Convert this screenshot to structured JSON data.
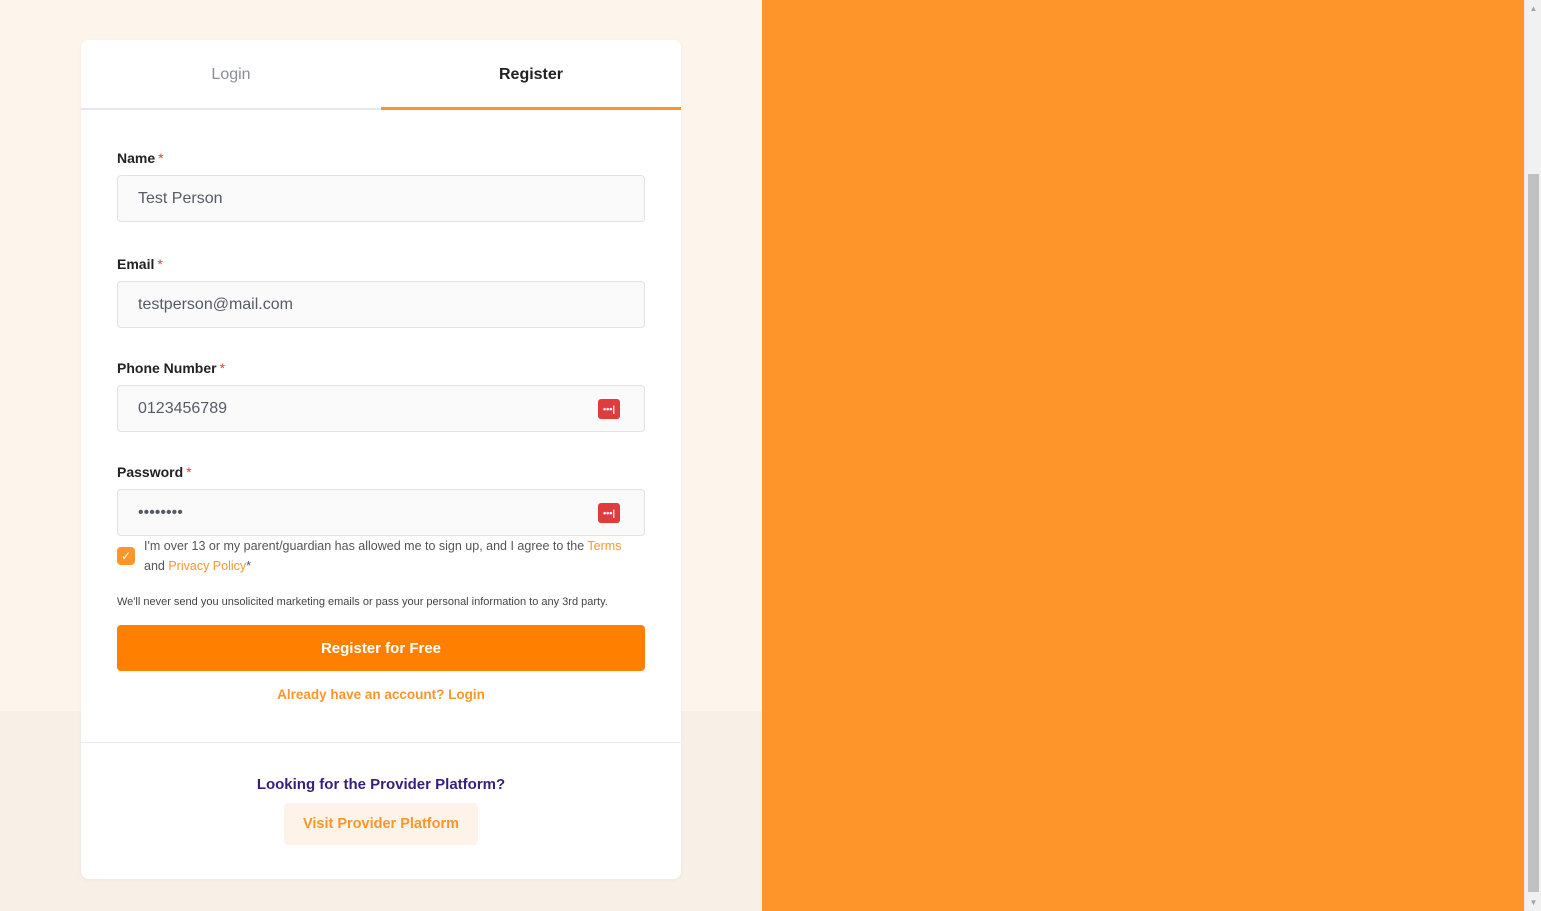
{
  "tabs": [
    {
      "label": "Login",
      "active": false
    },
    {
      "label": "Register",
      "active": true
    }
  ],
  "form": {
    "name": {
      "label": "Name",
      "required_mark": "*",
      "value": "Test Person"
    },
    "email": {
      "label": "Email",
      "required_mark": "*",
      "value": "testperson@mail.com"
    },
    "phone": {
      "label": "Phone Number",
      "required_mark": "*",
      "value": "0123456789",
      "icon": "password-manager-icon"
    },
    "password": {
      "label": "Password",
      "required_mark": "*",
      "value": "••••••••",
      "icon": "password-manager-icon"
    }
  },
  "consent": {
    "checked": true,
    "text_before": "I'm over 13 or my parent/guardian has allowed me to sign up, and I agree to the ",
    "terms_link": "Terms",
    "text_and": "and ",
    "privacy_link": "Privacy Policy",
    "required_mark": "*"
  },
  "privacy_note": "We'll never send you unsolicited marketing emails or pass your personal information to any 3rd party.",
  "register_button": "Register for Free",
  "login_link": "Already have an account? Login",
  "provider": {
    "heading": "Looking for the Provider Platform?",
    "button": "Visit Provider Platform"
  },
  "colors": {
    "accent": "#fe952b",
    "button": "#ff8000",
    "provider_heading": "#3a1e7b",
    "page_bg": "#fdf4ec"
  }
}
